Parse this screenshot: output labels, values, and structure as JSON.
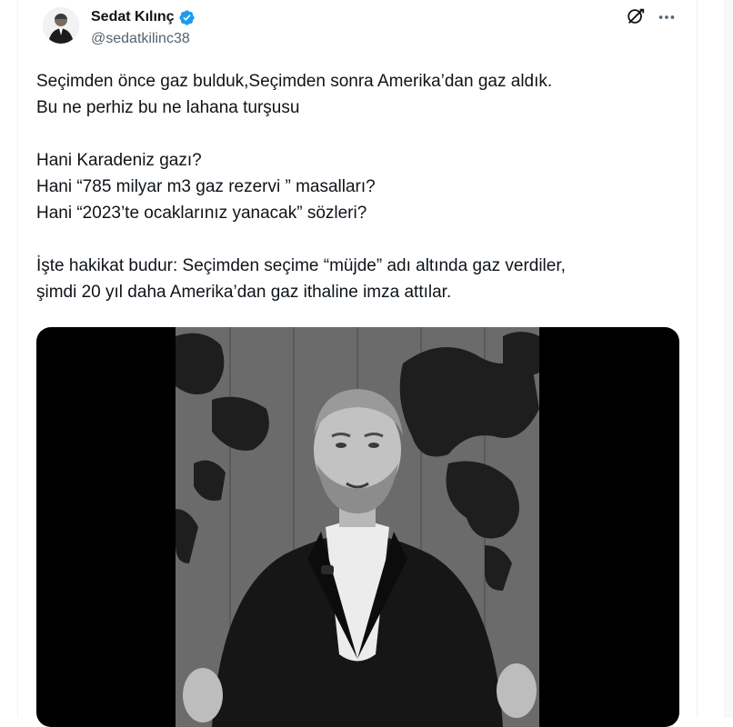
{
  "author": {
    "name": "Sedat Kılınç",
    "handle": "@sedatkilinc38",
    "avatar_icon": "person-avatar",
    "verified_color": "#1d9bf0"
  },
  "header_icons": [
    "grok-icon",
    "more-icon"
  ],
  "tweet": {
    "lines": [
      "Seçimden önce gaz bulduk,Seçimden sonra Amerika’dan gaz aldık.",
      "Bu ne perhiz bu ne lahana turşusu",
      "",
      "Hani Karadeniz gazı?",
      "Hani “785 milyar m3 gaz rezervi ” masalları?",
      "Hani “2023’te ocaklarınız yanacak” sözleri?",
      "",
      "İşte hakikat budur: Seçimden seçime “müjde” adı altında gaz verdiler,",
      "şimdi 20 yıl daha Amerika’dan gaz ithaline imza attılar."
    ]
  },
  "colors": {
    "text": "#0f1419",
    "secondary": "#536471",
    "media_bg": "#000000"
  }
}
